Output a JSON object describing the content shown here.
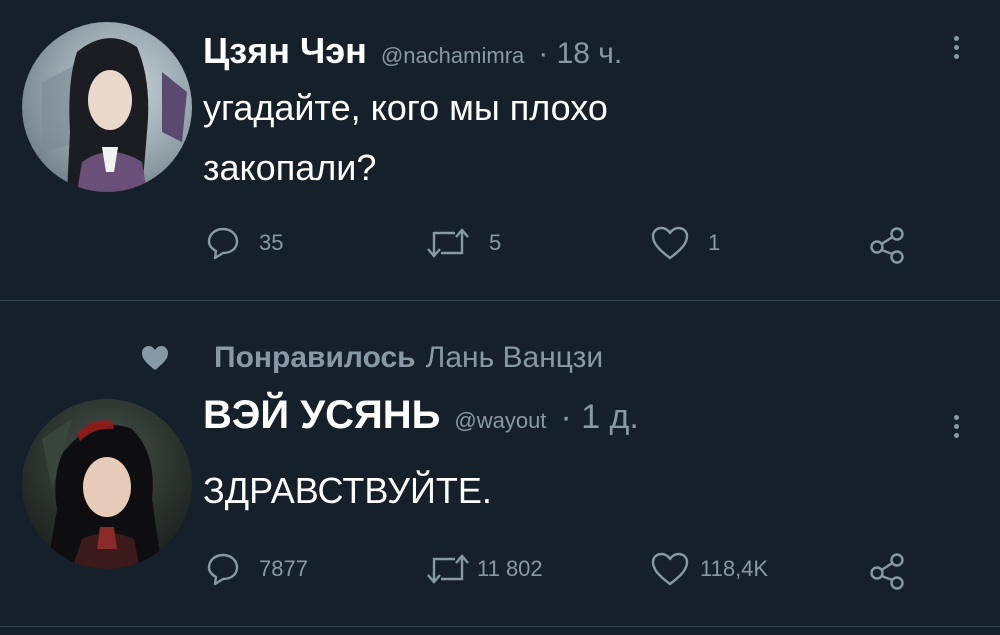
{
  "tweets": [
    {
      "author_name": "Цзян Чэн",
      "handle": "@nachamimra",
      "time": "· 18 ч.",
      "text_lines": [
        "угадайте, кого мы плохо",
        "закопали?"
      ],
      "replies": "35",
      "retweets": "5",
      "likes": "1"
    },
    {
      "liked_label": "Понравилось",
      "liked_by": "Лань Ванцзи",
      "author_name": "ВЭЙ УСЯНЬ",
      "handle": "@wayout",
      "time": "· 1 д.",
      "text_lines": [
        "ЗДРАВСТВУЙТЕ."
      ],
      "replies": "7877",
      "retweets": "11 802",
      "likes": "118,4K"
    }
  ],
  "icons": {
    "reply": "reply-icon",
    "retweet": "retweet-icon",
    "like": "heart-icon",
    "share": "share-icon",
    "more": "more-vertical-icon",
    "liked": "heart-filled-icon"
  },
  "colors": {
    "background": "#15202b",
    "muted": "#8899a6",
    "divider": "#38444d",
    "text": "#ffffff"
  }
}
